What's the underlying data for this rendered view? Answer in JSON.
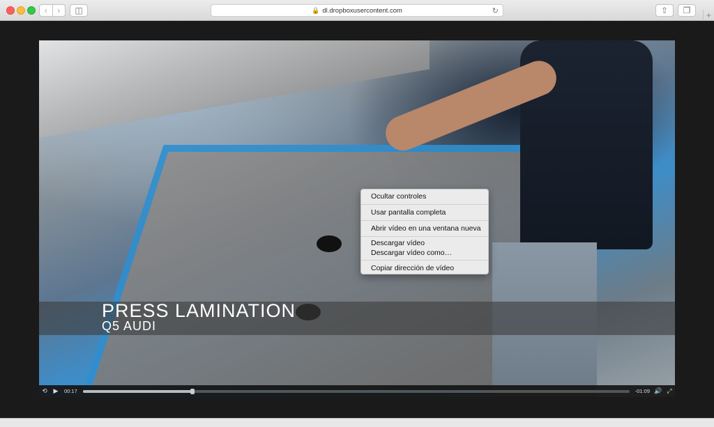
{
  "browser": {
    "url": "dl.dropboxusercontent.com",
    "icons": [
      "back-icon",
      "forward-icon",
      "sidebar-icon",
      "lock-icon",
      "reload-icon",
      "share-icon",
      "tabs-icon",
      "plus-icon"
    ]
  },
  "video": {
    "caption_title": "PRESS LAMINATION",
    "caption_subtitle": "Q5 AUDI",
    "elapsed": "00:17",
    "remaining": "-01:09",
    "progress": 0.2
  },
  "context_menu": {
    "hide_controls": "Ocultar controles",
    "fullscreen": "Usar pantalla completa",
    "open_new_window": "Abrir vídeo en una ventana nueva",
    "download": "Descargar vídeo",
    "download_as": "Descargar vídeo como…",
    "copy_address": "Copiar dirección de vídeo"
  }
}
